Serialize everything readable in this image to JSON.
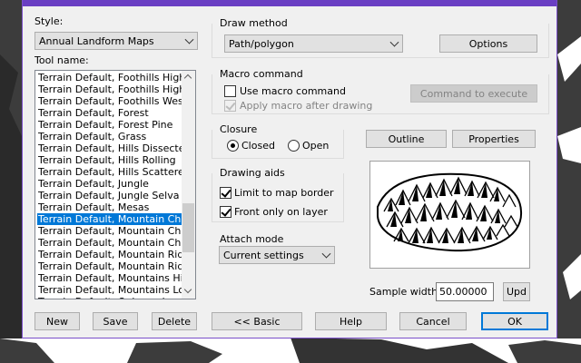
{
  "style": {
    "label": "Style:",
    "selected": "Annual Landform Maps"
  },
  "tool_name": {
    "label": "Tool name:",
    "items": [
      "Terrain Default, Foothills High Ea",
      "Terrain Default, Foothills High We",
      "Terrain Default, Foothills West Fa",
      "Terrain Default, Forest",
      "Terrain Default, Forest Pine",
      "Terrain Default, Grass",
      "Terrain Default, Hills Dissected",
      "Terrain Default, Hills Rolling",
      "Terrain Default, Hills Scattered",
      "Terrain Default, Jungle",
      "Terrain Default, Jungle Selva",
      "Terrain Default, Mesas",
      "Terrain Default, Mountain Chain E",
      "Terrain Default, Mountain Chain E",
      "Terrain Default, Mountain Chain N",
      "Terrain Default, Mountain Ridge",
      "Terrain Default, Mountain Ridge E",
      "Terrain Default, Mountains High",
      "Terrain Default, Mountains Low",
      "Terrain Default, Oaks and..."
    ],
    "selected_index": 12
  },
  "draw_method": {
    "label": "Draw method",
    "selected": "Path/polygon",
    "options_button": "Options"
  },
  "macro": {
    "label": "Macro command",
    "use_macro": "Use macro command",
    "use_macro_checked": false,
    "apply_after": "Apply macro after drawing",
    "apply_after_checked": true,
    "command_button": "Command to execute"
  },
  "closure": {
    "label": "Closure",
    "closed": "Closed",
    "open": "Open",
    "selected": "closed"
  },
  "buttons": {
    "outline": "Outline",
    "properties": "Properties",
    "new": "New",
    "save": "Save",
    "delete": "Delete",
    "basic": "<< Basic",
    "help": "Help",
    "cancel": "Cancel",
    "ok": "OK",
    "upd": "Upd"
  },
  "drawing_aids": {
    "label": "Drawing aids",
    "limit": "Limit to map border",
    "limit_checked": true,
    "front_only": "Front only on layer",
    "front_only_checked": true
  },
  "attach_mode": {
    "label": "Attach mode",
    "selected": "Current settings"
  },
  "sample_width": {
    "label": "Sample width:",
    "value": "50.00000"
  },
  "colors": {
    "accent": "#0078d7",
    "titlebar": "#6a3fc3",
    "dialog_bg": "#f0f0f0",
    "map_bg": "#3c3c3c"
  }
}
